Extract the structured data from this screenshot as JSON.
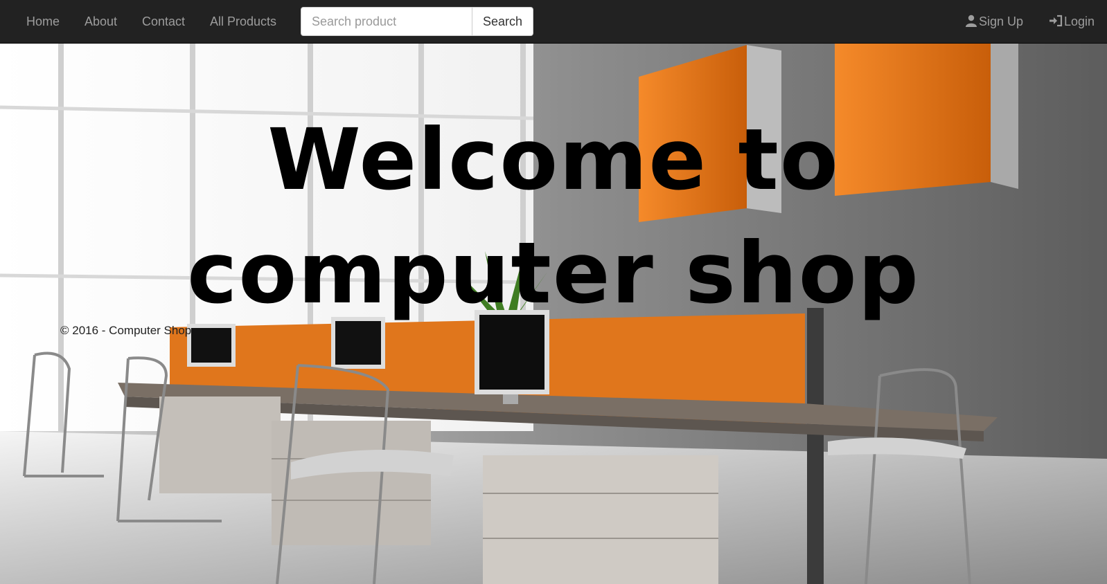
{
  "navbar": {
    "links": [
      "Home",
      "About",
      "Contact",
      "All Products"
    ],
    "search": {
      "placeholder": "Search product",
      "button_label": "Search"
    },
    "signup_label": "Sign Up",
    "login_label": "Login",
    "signup_icon": "user-icon",
    "login_icon": "log-in-icon"
  },
  "hero": {
    "headline": "Welcome to computer shop"
  },
  "footer": {
    "text": "© 2016 - Computer Shop"
  },
  "colors": {
    "navbar_bg": "#222222",
    "nav_text": "#9d9d9d",
    "accent_orange": "#f07a18"
  }
}
